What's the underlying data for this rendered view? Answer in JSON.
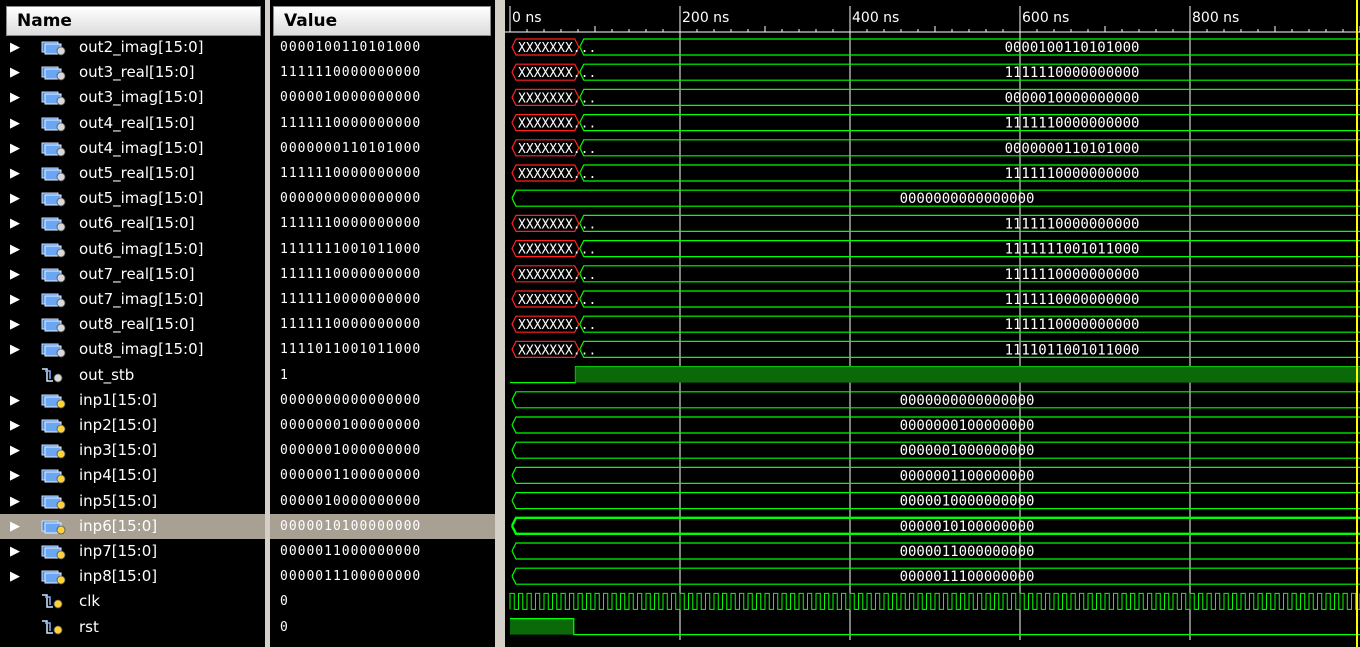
{
  "headers": {
    "name": "Name",
    "value": "Value"
  },
  "timeline": {
    "labels": [
      "0 ns",
      "200 ns",
      "400 ns",
      "600 ns",
      "800 ns"
    ],
    "range_ns": [
      0,
      1000
    ]
  },
  "colors": {
    "bus": "#00ff00",
    "undefined": "#ff2020",
    "cursor": "#ffff00",
    "grid": "#ffffff",
    "selected_row": "#a8a092"
  },
  "signals": [
    {
      "name": "out2_imag[15:0]",
      "value": "0000100110101000",
      "kind": "bus",
      "icon": "output-bus-icon",
      "expandable": true,
      "undefined_until_ns": 75,
      "bus_label": "0000100110101000"
    },
    {
      "name": "out3_real[15:0]",
      "value": "1111110000000000",
      "kind": "bus",
      "icon": "output-bus-icon",
      "expandable": true,
      "undefined_until_ns": 75,
      "bus_label": "1111110000000000"
    },
    {
      "name": "out3_imag[15:0]",
      "value": "0000010000000000",
      "kind": "bus",
      "icon": "output-bus-icon",
      "expandable": true,
      "undefined_until_ns": 75,
      "bus_label": "0000010000000000"
    },
    {
      "name": "out4_real[15:0]",
      "value": "1111110000000000",
      "kind": "bus",
      "icon": "output-bus-icon",
      "expandable": true,
      "undefined_until_ns": 75,
      "bus_label": "1111110000000000"
    },
    {
      "name": "out4_imag[15:0]",
      "value": "0000000110101000",
      "kind": "bus",
      "icon": "output-bus-icon",
      "expandable": true,
      "undefined_until_ns": 75,
      "bus_label": "0000000110101000"
    },
    {
      "name": "out5_real[15:0]",
      "value": "1111110000000000",
      "kind": "bus",
      "icon": "output-bus-icon",
      "expandable": true,
      "undefined_until_ns": 75,
      "bus_label": "1111110000000000"
    },
    {
      "name": "out5_imag[15:0]",
      "value": "0000000000000000",
      "kind": "bus",
      "icon": "output-bus-icon",
      "expandable": true,
      "undefined_until_ns": null,
      "bus_label": "0000000000000000"
    },
    {
      "name": "out6_real[15:0]",
      "value": "1111110000000000",
      "kind": "bus",
      "icon": "output-bus-icon",
      "expandable": true,
      "undefined_until_ns": 75,
      "bus_label": "1111110000000000"
    },
    {
      "name": "out6_imag[15:0]",
      "value": "1111111001011000",
      "kind": "bus",
      "icon": "output-bus-icon",
      "expandable": true,
      "undefined_until_ns": 75,
      "bus_label": "1111111001011000"
    },
    {
      "name": "out7_real[15:0]",
      "value": "1111110000000000",
      "kind": "bus",
      "icon": "output-bus-icon",
      "expandable": true,
      "undefined_until_ns": 75,
      "bus_label": "1111110000000000"
    },
    {
      "name": "out7_imag[15:0]",
      "value": "1111110000000000",
      "kind": "bus",
      "icon": "output-bus-icon",
      "expandable": true,
      "undefined_until_ns": 75,
      "bus_label": "1111110000000000"
    },
    {
      "name": "out8_real[15:0]",
      "value": "1111110000000000",
      "kind": "bus",
      "icon": "output-bus-icon",
      "expandable": true,
      "undefined_until_ns": 75,
      "bus_label": "1111110000000000"
    },
    {
      "name": "out8_imag[15:0]",
      "value": "1111011001011000",
      "kind": "bus",
      "icon": "output-bus-icon",
      "expandable": true,
      "undefined_until_ns": 75,
      "bus_label": "1111011001011000"
    },
    {
      "name": "out_stb",
      "value": "1",
      "kind": "bit",
      "icon": "output-bit-icon",
      "expandable": false,
      "high_from_ns": 77
    },
    {
      "name": "inp1[15:0]",
      "value": "0000000000000000",
      "kind": "bus",
      "icon": "input-bus-icon",
      "expandable": true,
      "undefined_until_ns": null,
      "bus_label": "0000000000000000"
    },
    {
      "name": "inp2[15:0]",
      "value": "0000000100000000",
      "kind": "bus",
      "icon": "input-bus-icon",
      "expandable": true,
      "undefined_until_ns": null,
      "bus_label": "0000000100000000"
    },
    {
      "name": "inp3[15:0]",
      "value": "0000001000000000",
      "kind": "bus",
      "icon": "input-bus-icon",
      "expandable": true,
      "undefined_until_ns": null,
      "bus_label": "0000001000000000"
    },
    {
      "name": "inp4[15:0]",
      "value": "0000001100000000",
      "kind": "bus",
      "icon": "input-bus-icon",
      "expandable": true,
      "undefined_until_ns": null,
      "bus_label": "0000001100000000"
    },
    {
      "name": "inp5[15:0]",
      "value": "0000010000000000",
      "kind": "bus",
      "icon": "input-bus-icon",
      "expandable": true,
      "undefined_until_ns": null,
      "bus_label": "0000010000000000"
    },
    {
      "name": "inp6[15:0]",
      "value": "0000010100000000",
      "kind": "bus",
      "icon": "input-bus-icon",
      "expandable": true,
      "undefined_until_ns": null,
      "bus_label": "0000010100000000",
      "selected": true
    },
    {
      "name": "inp7[15:0]",
      "value": "0000011000000000",
      "kind": "bus",
      "icon": "input-bus-icon",
      "expandable": true,
      "undefined_until_ns": null,
      "bus_label": "0000011000000000"
    },
    {
      "name": "inp8[15:0]",
      "value": "0000011100000000",
      "kind": "bus",
      "icon": "input-bus-icon",
      "expandable": true,
      "undefined_until_ns": null,
      "bus_label": "0000011100000000"
    },
    {
      "name": "clk",
      "value": "0",
      "kind": "clock",
      "icon": "input-bit-icon",
      "expandable": false,
      "period_ns": 10
    },
    {
      "name": "rst",
      "value": "0",
      "kind": "bit",
      "icon": "input-bit-icon",
      "expandable": false,
      "high_until_ns": 75
    }
  ],
  "undefined_label": "XXXXXXX..."
}
